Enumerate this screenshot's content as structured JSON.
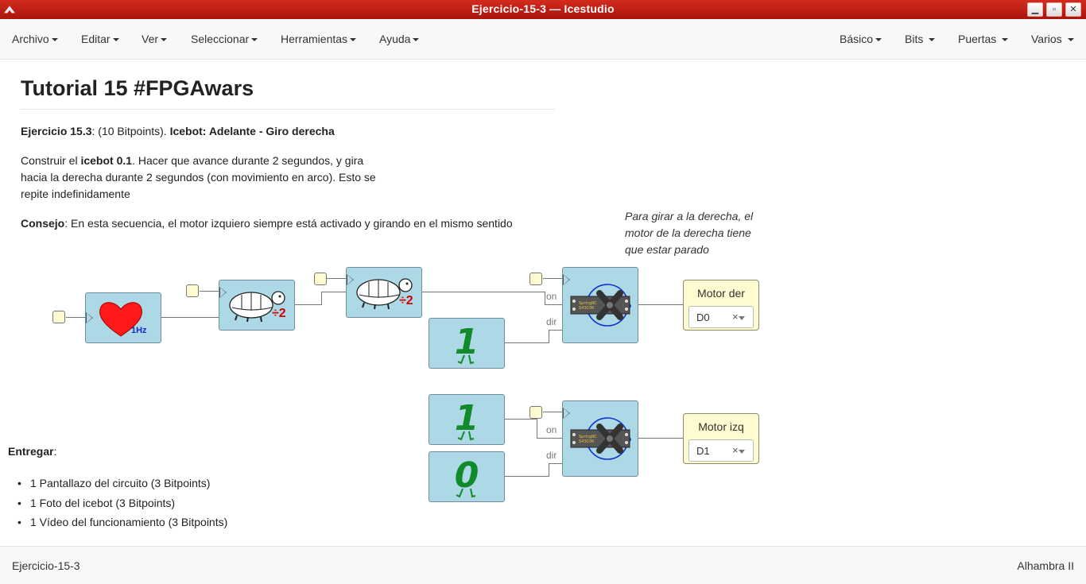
{
  "window": {
    "title": "Ejercicio-15-3 — Icestudio"
  },
  "menubar": {
    "left": [
      "Archivo",
      "Editar",
      "Ver",
      "Seleccionar",
      "Herramientas",
      "Ayuda"
    ],
    "right": [
      "Básico",
      "Bits",
      "Puertas",
      "Varios"
    ]
  },
  "doc": {
    "title": "Tutorial 15 #FPGAwars",
    "exercise_label": "Ejercicio 15.3",
    "exercise_points": ": (10 Bitpoints). ",
    "exercise_name": "Icebot: Adelante - Giro derecha",
    "build_prefix": "Construir el ",
    "build_bold": "icebot 0.1",
    "build_line1_rest": ". Hacer que avance durante 2 segundos, y gira",
    "build_line2": "hacia la derecha durante 2 segundos (con movimiento en arco). Esto se",
    "build_line3": "repite indefinidamente",
    "tip_label": "Consejo",
    "tip_text": ": En esta secuencia, el motor izquiero siempre está activado y girando en el mismo sentido",
    "note_lines": [
      "Para girar a la derecha, el",
      "motor de la derecha tiene",
      "que estar parado"
    ],
    "deliver_label": "Entregar",
    "deliver_colon": ":",
    "deliver_items": [
      "1 Pantallazo del circuito (3 Bitpoints)",
      "1 Foto del icebot (3 Bitpoints)",
      "1 Vídeo del funcionamiento (3 Bitpoints)"
    ]
  },
  "circuit": {
    "heart_label": "1Hz",
    "div_label": "÷2",
    "const_top": "1",
    "const_mid": "1",
    "const_bottom": "0",
    "port_on": "on",
    "port_dir": "dir",
    "servo_chip": "SpringRC SM-S4303R",
    "motor_der": {
      "name": "Motor der",
      "pin": "D0",
      "clear": "×"
    },
    "motor_izq": {
      "name": "Motor izq",
      "pin": "D1",
      "clear": "×"
    }
  },
  "status": {
    "left": "Ejercicio-15-3",
    "right": "Alhambra II"
  },
  "colors": {
    "titlebar": "#c01f14",
    "block": "#add8e6",
    "pin": "#fdfbcf",
    "const": "#118a2a",
    "heart": "#ff1a1a",
    "divisor": "#d40000"
  }
}
